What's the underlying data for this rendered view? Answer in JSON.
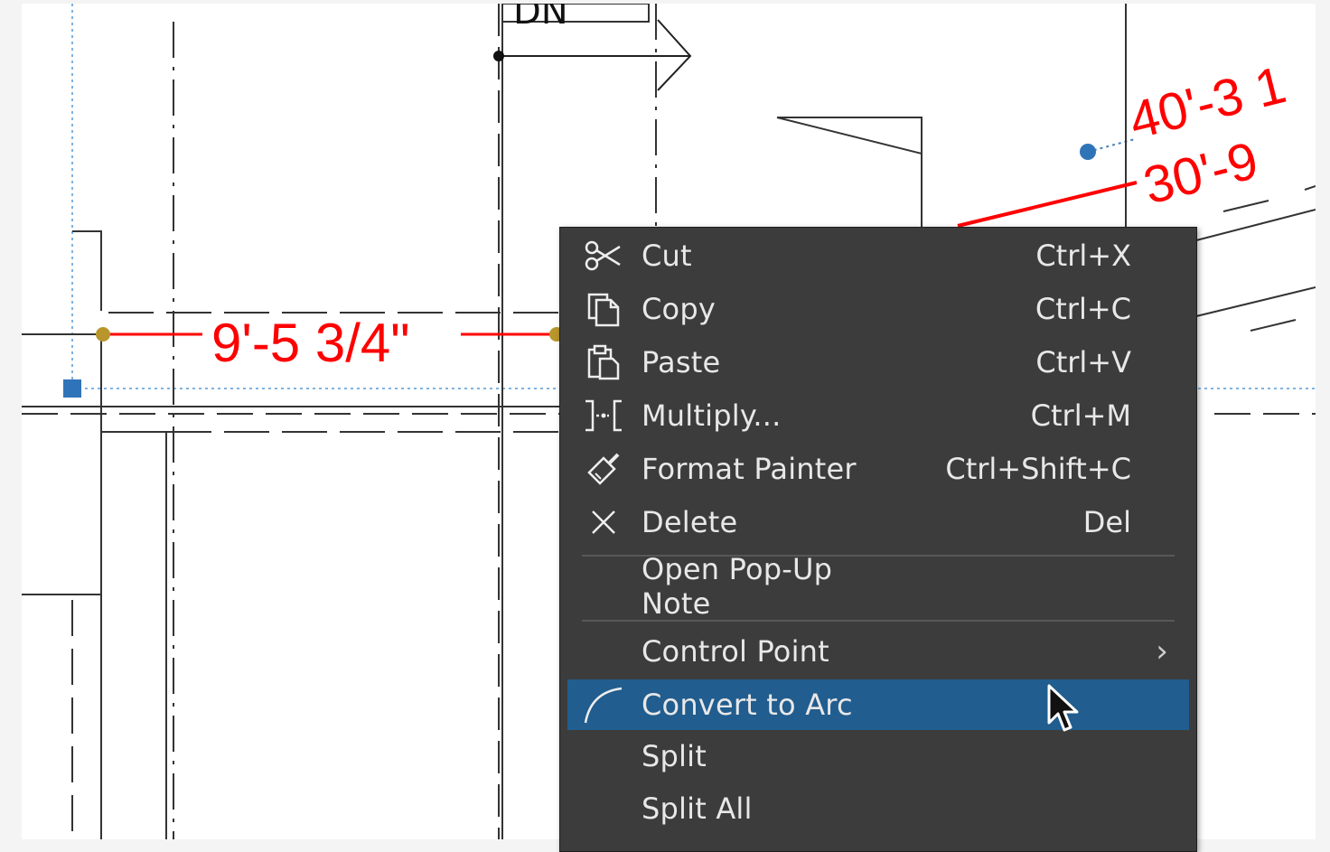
{
  "drawing": {
    "dimensions": [
      {
        "text": "9'-5 3/4\"",
        "color": "#ff0000"
      },
      {
        "text": "40'-3 1",
        "color": "#ff0000"
      },
      {
        "text": "30'-9",
        "color": "#ff0000"
      }
    ],
    "label_dn": "DN"
  },
  "menu": {
    "items": [
      {
        "label": "Cut",
        "shortcut": "Ctrl+X",
        "icon": "scissors-icon"
      },
      {
        "label": "Copy",
        "shortcut": "Ctrl+C",
        "icon": "copy-icon"
      },
      {
        "label": "Paste",
        "shortcut": "Ctrl+V",
        "icon": "paste-icon"
      },
      {
        "label": "Multiply...",
        "shortcut": "Ctrl+M",
        "icon": "multiply-icon"
      },
      {
        "label": "Format Painter",
        "shortcut": "Ctrl+Shift+C",
        "icon": "format-painter-icon"
      },
      {
        "label": "Delete",
        "shortcut": "Del",
        "icon": "close-icon"
      },
      {
        "label": "Open Pop-Up Note",
        "shortcut": "",
        "icon": ""
      },
      {
        "label": "Control Point",
        "shortcut": "",
        "icon": "",
        "submenu": "›"
      },
      {
        "label": "Convert to Arc",
        "shortcut": "",
        "icon": "arc-icon",
        "highlighted": true
      },
      {
        "label": "Split",
        "shortcut": "",
        "icon": ""
      },
      {
        "label": "Split All",
        "shortcut": "",
        "icon": ""
      }
    ]
  },
  "colors": {
    "menu_bg": "#3c3c3c",
    "highlight": "#215d8e",
    "dimension_red": "#ff0000",
    "selection_blue": "#2f74b8"
  }
}
